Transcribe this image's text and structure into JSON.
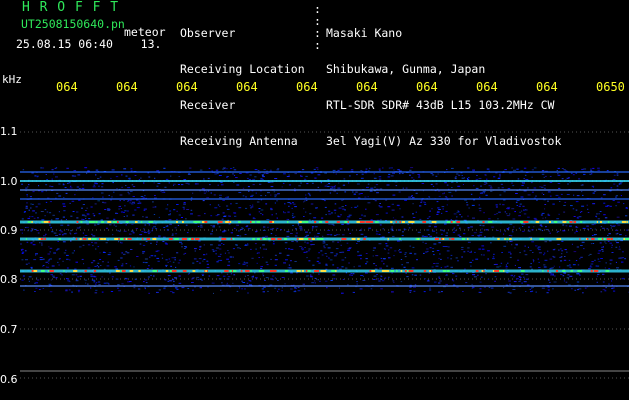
{
  "header": {
    "logo": "H R O F F T",
    "filename": "UT2508150640.pn",
    "meteor_label": "meteor",
    "datetime": "25.08.15 06:40",
    "count": "13.",
    "fields": [
      {
        "label": "Observer",
        "value": "Masaki Kano"
      },
      {
        "label": "Receiving Location",
        "value": "Shibukawa, Gunma, Japan"
      },
      {
        "label": "Receiver",
        "value": "RTL-SDR SDR# 43dB L15 103.2MHz CW"
      },
      {
        "label": "Receiving Antenna",
        "value": "3el Yagi(V) Az 330 for Vladivostok"
      }
    ]
  },
  "axes": {
    "y_unit": "kHz",
    "y_ticks": [
      "1.1",
      "1.0",
      "0.9",
      "0.8",
      "0.7",
      "0.6"
    ],
    "time_ticks": [
      "064",
      "064",
      "064",
      "064",
      "064",
      "064",
      "064",
      "064",
      "064",
      "0650"
    ]
  },
  "colors": {
    "background": "#000000",
    "text": "#ffffff",
    "logo": "#2fe85a",
    "time_labels": "#ffff22",
    "spectrum_noise": "#0a1fd0",
    "signal_strong": "#ff3a2a",
    "signal_mid": "#38e0ff",
    "meteor_echo": "#ffff00"
  }
}
